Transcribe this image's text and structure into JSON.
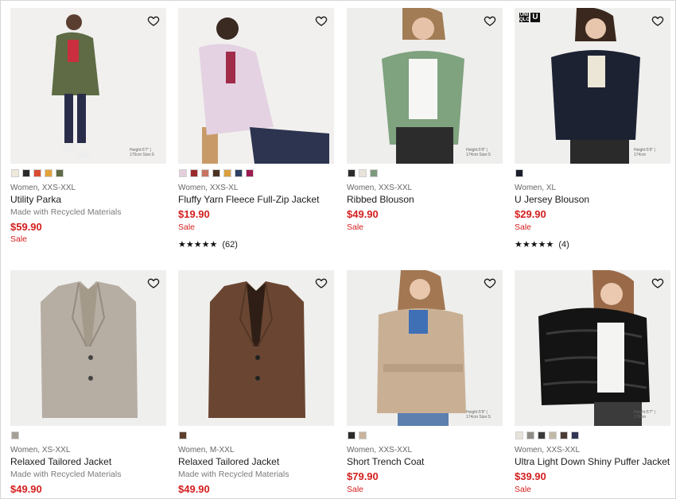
{
  "products": [
    {
      "meta": "Women, XXS-XXL",
      "name": "Utility Parka",
      "sub": "Made with Recycled Materials",
      "price": "$59.90",
      "sale": "Sale",
      "model_note": "Height:5'7\" | 170cm Size:S",
      "swatches": [
        "#efe9dc",
        "#2b2b2b",
        "#d94c32",
        "#e3a23a",
        "#5e6b44"
      ]
    },
    {
      "meta": "Women, XXS-XL",
      "name": "Fluffy Yarn Fleece Full-Zip Jacket",
      "price": "$19.90",
      "sale": "Sale",
      "stars": "★★★★★",
      "reviews": "(62)",
      "rating_value": 4.5,
      "swatches": [
        "#e3cfdc",
        "#9a2b2b",
        "#c77463",
        "#4a3324",
        "#d9a03e",
        "#2f3f63",
        "#9c1c52"
      ]
    },
    {
      "meta": "Women, XXS-XXL",
      "name": "Ribbed Blouson",
      "price": "$49.90",
      "sale": "Sale",
      "model_note": "Height:5'9\" | 174cm Size:S",
      "swatches": [
        "#2b2b2b",
        "#e9e4da",
        "#7d9a7b"
      ]
    },
    {
      "meta": "Women, XL",
      "name": "U Jersey Blouson",
      "price": "$29.90",
      "sale": "Sale",
      "stars": "★★★★★",
      "reviews": "(4)",
      "rating_value": 4.5,
      "model_note": "Height:5'9\" | 174cm",
      "swatches": [
        "#1b1e2b"
      ]
    },
    {
      "meta": "Women, XS-XXL",
      "name": "Relaxed Tailored Jacket",
      "sub": "Made with Recycled Materials",
      "price": "$49.90",
      "swatches": [
        "#a59f96"
      ]
    },
    {
      "meta": "Women, M-XXL",
      "name": "Relaxed Tailored Jacket",
      "sub": "Made with Recycled Materials",
      "price": "$49.90",
      "swatches": [
        "#5d3f2e"
      ]
    },
    {
      "meta": "Women, XXS-XXL",
      "name": "Short Trench Coat",
      "price": "$79.90",
      "sale": "Sale",
      "model_note": "Height:5'9\" | 174cm Size:S",
      "swatches": [
        "#2b2b2b",
        "#c9b49e"
      ]
    },
    {
      "meta": "Women, XXS-XXL",
      "name": "Ultra Light Down Shiny Puffer Jacket",
      "price": "$39.90",
      "sale": "Sale",
      "model_note": "Height:5'7\" | 170cm",
      "swatches": [
        "#e8e3da",
        "#8f8c86",
        "#3a3a3a",
        "#c2b8a7",
        "#4c3b35",
        "#2f3552"
      ]
    }
  ],
  "colors": {
    "sale": "#d41e1e",
    "text": "#1b1b1b",
    "muted": "#666666"
  },
  "icons": {
    "wishlist": "heart-outline-icon",
    "rating": "star-icon"
  }
}
